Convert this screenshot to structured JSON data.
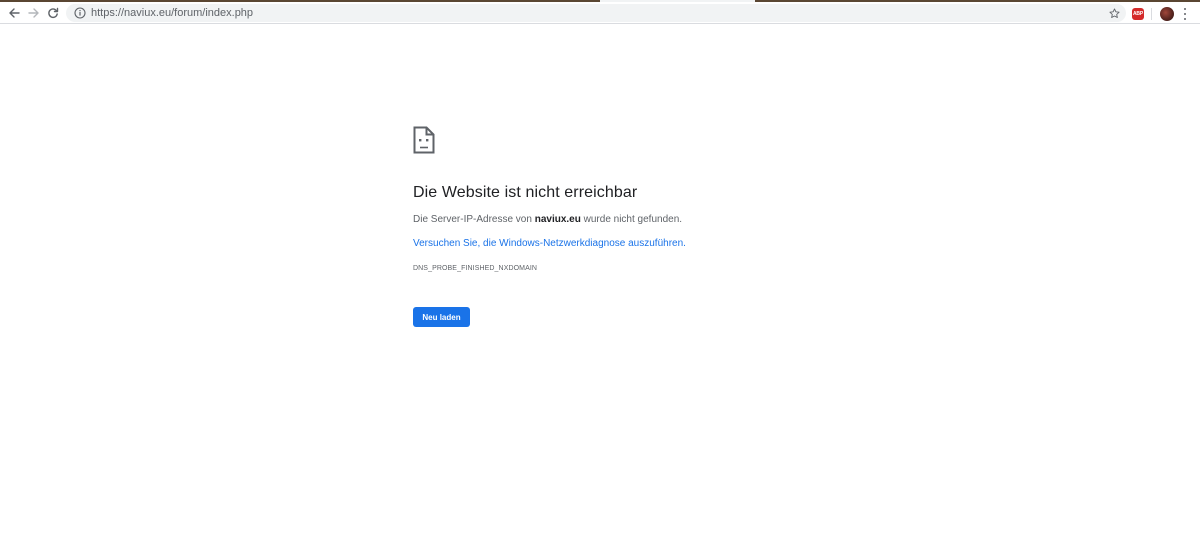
{
  "browser": {
    "url": "https://naviux.eu/forum/index.php",
    "extension_abp_label": "ABP"
  },
  "error": {
    "title": "Die Website ist nicht erreichbar",
    "desc_prefix": "Die Server-IP-Adresse von ",
    "desc_domain": "naviux.eu",
    "desc_suffix": " wurde nicht gefunden.",
    "diagnose_link": "Versuchen Sie, die Windows-Netzwerkdiagnose auszuführen.",
    "error_code": "DNS_PROBE_FINISHED_NXDOMAIN",
    "reload_label": "Neu laden"
  },
  "colors": {
    "accent": "#1a73e8",
    "abp_red": "#d42a2a"
  }
}
